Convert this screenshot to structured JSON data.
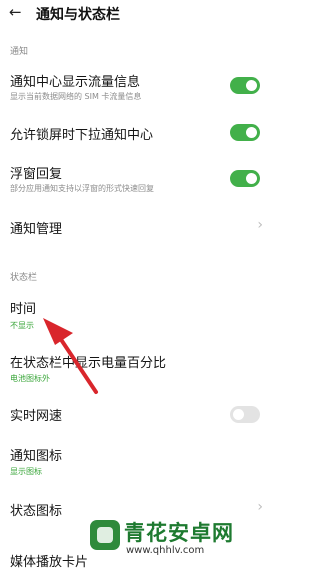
{
  "header": {
    "title": "通知与状态栏",
    "back_icon": "back-arrow-icon"
  },
  "sections": {
    "notify": "通知",
    "statusbar": "状态栏"
  },
  "rows": [
    {
      "title": "通知中心显示流量信息",
      "subtitle": "显示当前数据网络的 SIM 卡流量信息",
      "toggle": true
    },
    {
      "title": "允许锁屏时下拉通知中心",
      "toggle": true
    },
    {
      "title": "浮窗回复",
      "subtitle": "部分应用通知支持以浮窗的形式快速回复",
      "toggle": true
    },
    {
      "title": "通知管理"
    },
    {
      "title": "时间",
      "subtitle": "不显示"
    },
    {
      "title": "在状态栏中显示电量百分比",
      "subtitle": "电池图标外"
    },
    {
      "title": "实时网速",
      "toggle": false
    },
    {
      "title": "通知图标",
      "subtitle": "显示图标"
    },
    {
      "title": "状态图标"
    },
    {
      "title": "媒体播放卡片"
    }
  ],
  "watermark": {
    "name": "青花安卓网",
    "url": "www.qhhlv.com"
  },
  "colors": {
    "toggle_on": "#42b04a",
    "accent_green": "#3aa63a",
    "arrow_red": "#d9262c"
  }
}
